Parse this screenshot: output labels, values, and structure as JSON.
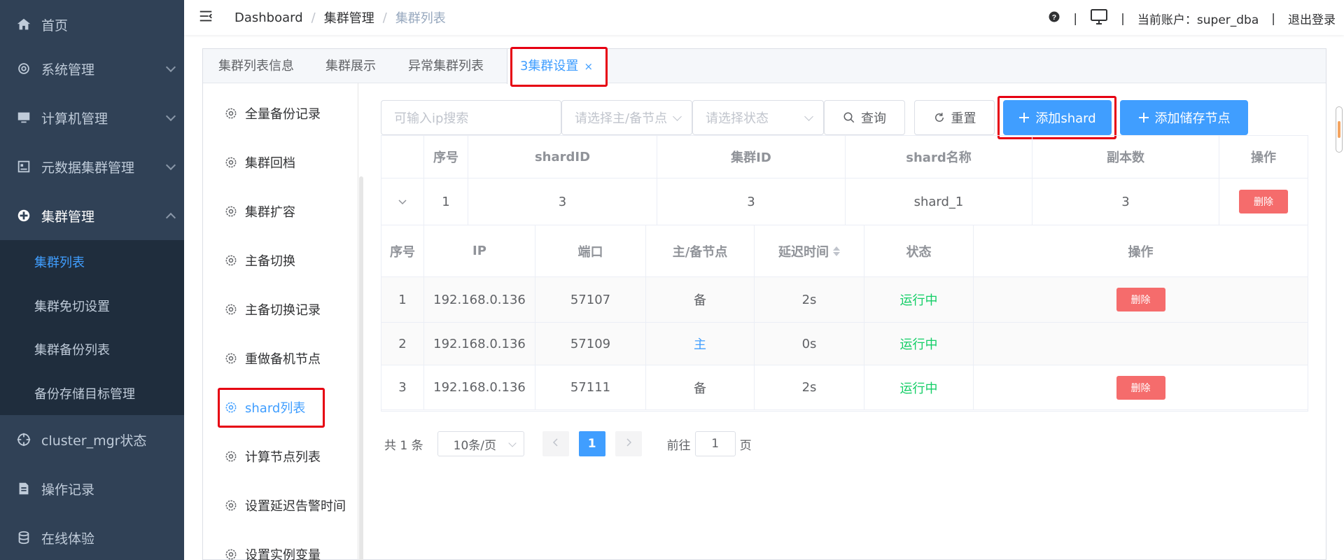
{
  "sidebar": {
    "items": [
      {
        "label": "首页",
        "icon": "home-icon"
      },
      {
        "label": "系统管理",
        "icon": "gear-icon"
      },
      {
        "label": "计算机管理",
        "icon": "monitor-icon"
      },
      {
        "label": "元数据集群管理",
        "icon": "database-card-icon"
      },
      {
        "label": "集群管理",
        "icon": "cluster-icon"
      },
      {
        "label": "cluster_mgr状态",
        "icon": "crosshair-icon"
      },
      {
        "label": "操作记录",
        "icon": "document-icon"
      },
      {
        "label": "在线体验",
        "icon": "cylinder-icon"
      }
    ],
    "submenu": [
      {
        "label": "集群列表"
      },
      {
        "label": "集群免切设置"
      },
      {
        "label": "集群备份列表"
      },
      {
        "label": "备份存储目标管理"
      }
    ]
  },
  "navbar": {
    "breadcrumb": [
      "Dashboard",
      "集群管理",
      "集群列表"
    ],
    "separator": "/",
    "account_label": "当前账户：super_dba",
    "logout_label": "退出登录",
    "pipe": "|"
  },
  "tabs": [
    {
      "label": "集群列表信息"
    },
    {
      "label": "集群展示"
    },
    {
      "label": "异常集群列表"
    },
    {
      "label": "3集群设置",
      "close": "×"
    }
  ],
  "inner_menu": [
    {
      "label": "全量备份记录"
    },
    {
      "label": "集群回档"
    },
    {
      "label": "集群扩容"
    },
    {
      "label": "主备切换"
    },
    {
      "label": "主备切换记录"
    },
    {
      "label": "重做备机节点"
    },
    {
      "label": "shard列表"
    },
    {
      "label": "计算节点列表"
    },
    {
      "label": "设置延迟告警时间"
    },
    {
      "label": "设置实例变量"
    }
  ],
  "filters": {
    "ip_placeholder": "可输入ip搜索",
    "role_placeholder": "请选择主/备节点",
    "status_placeholder": "请选择状态",
    "search_label": "查询",
    "reset_label": "重置",
    "add_shard_label": "添加shard",
    "add_storage_label": "添加储存节点"
  },
  "outer_table": {
    "headers": [
      "",
      "序号",
      "shardID",
      "集群ID",
      "shard名称",
      "副本数",
      "操作"
    ],
    "row": {
      "index": "1",
      "shard_id": "3",
      "cluster_id": "3",
      "shard_name": "shard_1",
      "replicas": "3",
      "delete": "删除"
    }
  },
  "inner_table": {
    "headers": [
      "序号",
      "IP",
      "端口",
      "主/备节点",
      "延迟时间",
      "状态",
      "操作"
    ],
    "rows": [
      {
        "index": "1",
        "ip": "192.168.0.136",
        "port": "57107",
        "role": "备",
        "delay": "2s",
        "status": "运行中",
        "delete": "删除"
      },
      {
        "index": "2",
        "ip": "192.168.0.136",
        "port": "57109",
        "role": "主",
        "delay": "0s",
        "status": "运行中",
        "delete": ""
      },
      {
        "index": "3",
        "ip": "192.168.0.136",
        "port": "57111",
        "role": "备",
        "delay": "2s",
        "status": "运行中",
        "delete": "删除"
      }
    ]
  },
  "pagination": {
    "total": "共 1 条",
    "page_size": "10条/页",
    "current": "1",
    "goto_prefix": "前往",
    "goto_value": "1",
    "goto_suffix": "页"
  },
  "colors": {
    "primary": "#409eff",
    "danger": "#f56c6c",
    "success": "#13ce66",
    "sidebar": "#304156",
    "highlight": "#e60012"
  }
}
